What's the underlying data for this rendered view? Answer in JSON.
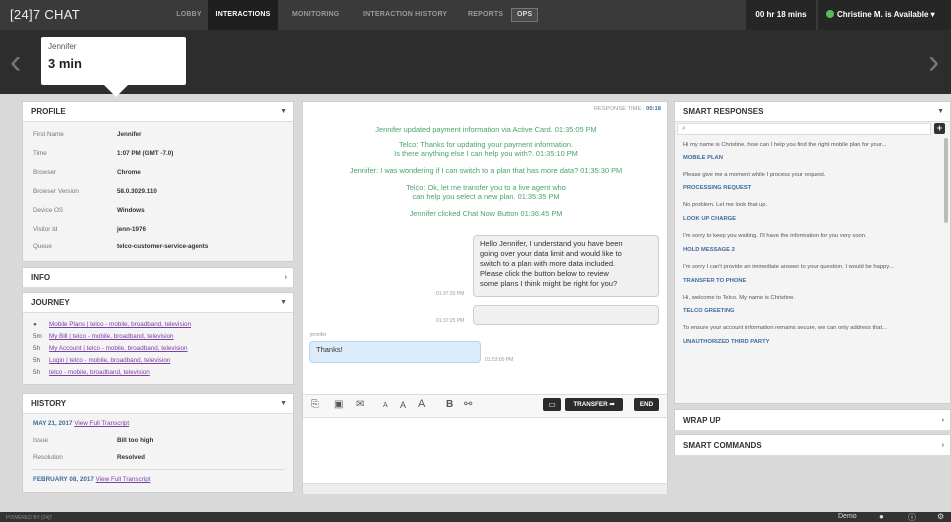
{
  "app": {
    "logo": "[24]7 CHAT"
  },
  "nav": {
    "lobby": "LOBBY",
    "interactions": "INTERACTIONS",
    "monitoring": "MONITORING",
    "history": "INTERACTION HISTORY",
    "reports": "REPORTS",
    "ops": "OPS"
  },
  "header": {
    "timer": "00 hr 18 mins",
    "status": "Christine M. is Available"
  },
  "active_card": {
    "name": "Jennifer",
    "time": "3 min"
  },
  "profile": {
    "title": "PROFILE",
    "rows": [
      {
        "k": "First Name",
        "v": "Jennifer"
      },
      {
        "k": "Time",
        "v": "1:07 PM (GMT -7.0)"
      },
      {
        "k": "Browser",
        "v": "Chrome"
      },
      {
        "k": "Browser Version",
        "v": "58.0.3029.110"
      },
      {
        "k": "Device OS",
        "v": "Windows"
      },
      {
        "k": "Visitor Id",
        "v": "jenn-1976"
      },
      {
        "k": "Queue",
        "v": "telco-customer-service-agents"
      }
    ]
  },
  "info": {
    "title": "INFO"
  },
  "journey": {
    "title": "JOURNEY",
    "items": [
      {
        "t": "●",
        "label": "Mobile Plans | telco - mobile, broadband, television"
      },
      {
        "t": "5m",
        "label": "My Bill | telco - mobile, broadband, television"
      },
      {
        "t": "5h",
        "label": "My Account | telco - mobile, broadband, television"
      },
      {
        "t": "5h",
        "label": "Login | telco - mobile, broadband, television"
      },
      {
        "t": "5h",
        "label": "telco - mobile, broadband, television"
      }
    ]
  },
  "history": {
    "title": "HISTORY",
    "view": "View Full Transcript",
    "entry1": {
      "date": "MAY 21, 2017",
      "issue_k": "Issue",
      "issue_v": "Bill too high",
      "res_k": "Resolution",
      "res_v": "Resolved"
    },
    "entry2": {
      "date": "FEBRUARY 08, 2017"
    }
  },
  "chat": {
    "response_label": "RESPONSE TIME :",
    "response_time": "00:18",
    "sys": [
      "Jennifer updated payment information via Active Card. 01:35:05 PM",
      "Telco: Thanks for updating your payment information.",
      "Is there anything else I can help you with?. 01:35:10 PM",
      "Jennifer: I was wondering if I can switch to a plan that has more data? 01:35:30 PM",
      "Telco: Ok, let me transfer you to a live agent who",
      "can help you select a new plan. 01:35:35 PM",
      "Jennifer clicked Chat Now Button 01:36:45 PM"
    ],
    "agent_lines": [
      "Hello Jennifer, I understand you have been",
      "going over your data limit and would like to",
      "switch to a plan with more data included.",
      "Please click the button below to review",
      "some plans I think might be right for you?"
    ],
    "agent_time": "01:37:20 PM",
    "second_time": "01:37:25 PM",
    "customer_name": "jennifer",
    "customer_msg": "Thanks!",
    "customer_time": "01:53:00 PM",
    "transfer": "TRANSFER",
    "end": "END",
    "tb_a1": "A",
    "tb_a2": "A",
    "tb_a3": "A",
    "tb_b": "B"
  },
  "smart": {
    "title": "SMART RESPONSES",
    "search_placeholder": "⌕",
    "items": [
      {
        "text": "Hi my name is Christine, how can I help you find the right mobile plan for your...",
        "heading": "MOBILE PLAN"
      },
      {
        "text": "Please give me a moment while I process your request.",
        "heading": "PROCESSING REQUEST"
      },
      {
        "text": "No problem. Let me look that up.",
        "heading": "LOOK UP CHARGE"
      },
      {
        "text": "I'm sorry to keep you waiting. I'll have the information for you very soon.",
        "heading": "HOLD MESSAGE 2"
      },
      {
        "text": "I'm sorry I can't provide an immediate answer to your question. I would be happy...",
        "heading": "TRANSFER TO PHONE"
      },
      {
        "text": "Hi, welcome to Telco. My name is Christine.",
        "heading": "TELCO GREETING"
      },
      {
        "text": "To ensure your account information remains secure, we can only address that...",
        "heading": "UNAUTHORIZED THIRD PARTY"
      }
    ]
  },
  "wrap": {
    "title": "WRAP UP"
  },
  "commands": {
    "title": "SMART COMMANDS"
  },
  "footer": {
    "powered": "POWERED BY [24]7",
    "demo": "Demo"
  }
}
